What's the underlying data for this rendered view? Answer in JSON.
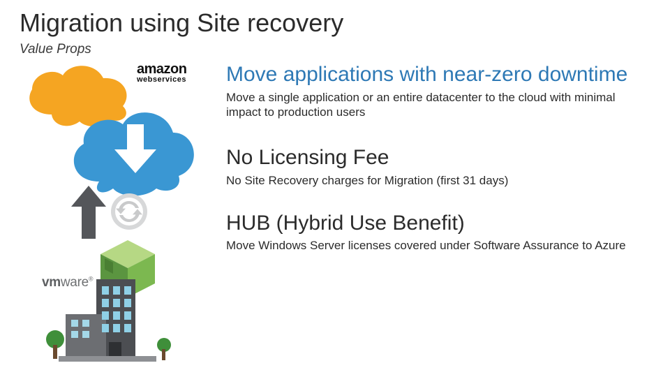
{
  "title": "Migration using Site recovery",
  "subtitle": "Value Props",
  "logos": {
    "aws_line1": "amazon",
    "aws_line2": "webservices",
    "vmware_part1": "vm",
    "vmware_part2": "ware",
    "vmware_tm": "®"
  },
  "blocks": [
    {
      "heading": "Move applications with near-zero downtime",
      "accent": true,
      "body": "Move a single application or an entire datacenter to the cloud with minimal impact to production users"
    },
    {
      "heading": "No Licensing Fee",
      "accent": false,
      "body": "No Site Recovery charges for Migration (first 31 days)"
    },
    {
      "heading": "HUB (Hybrid Use Benefit)",
      "accent": false,
      "body": "Move Windows Server licenses covered under Software Assurance to Azure"
    }
  ]
}
